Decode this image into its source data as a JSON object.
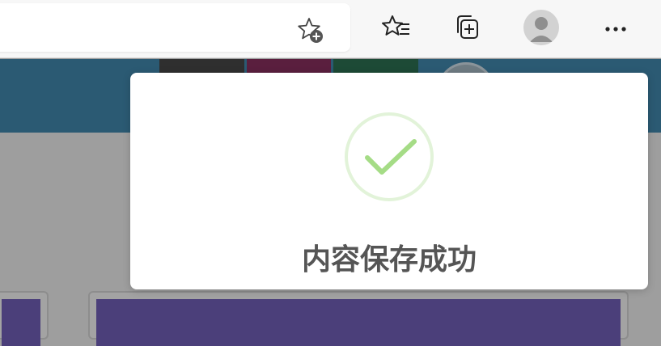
{
  "browser": {
    "toolbar": {
      "address_bar_favorite_icon": "star-plus-icon",
      "favorites_icon": "favorites-list-icon",
      "collections_icon": "collections-icon",
      "profile_icon": "profile-avatar",
      "more_icon": "ellipsis-icon"
    }
  },
  "toast": {
    "icon": "check-icon",
    "message": "内容保存成功",
    "accent_color": "#a5dc86",
    "ring_color": "#e2f3d9"
  },
  "colors": {
    "banner": "#2b5a73",
    "overlay": "#9e9e9e",
    "card_accent": "#4b3f7a"
  }
}
